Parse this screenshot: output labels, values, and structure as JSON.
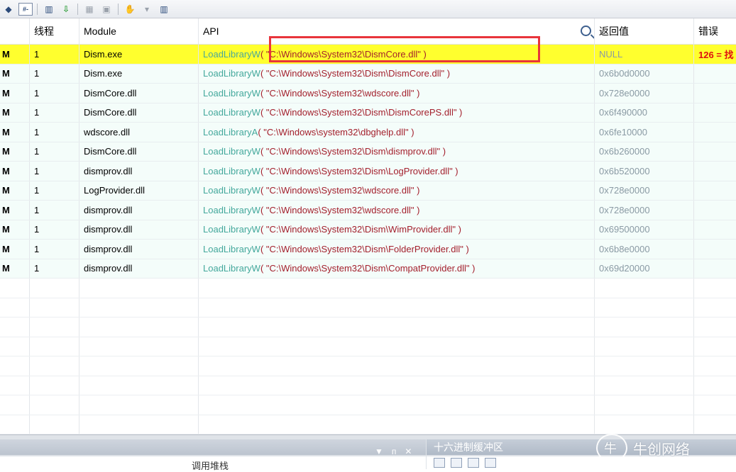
{
  "toolbar": {
    "buttons": [
      {
        "icon": "process-icon"
      },
      {
        "icon": "filter-icon",
        "label": "#-"
      },
      {
        "icon": "columns-icon"
      },
      {
        "icon": "green-arrow-icon"
      },
      {
        "icon": "copy-icon"
      },
      {
        "icon": "delete-icon"
      },
      {
        "icon": "hand-icon"
      },
      {
        "icon": "dropdown-icon"
      },
      {
        "icon": "clear-icon"
      }
    ]
  },
  "table": {
    "headers": [
      "",
      "线程",
      "Module",
      "API",
      "返回值",
      "错误"
    ],
    "rows": [
      {
        "col0": "M",
        "thread": "1",
        "module": "Dism.exe",
        "fn": "LoadLibraryW",
        "args": " ( \"C:\\Windows\\System32\\DismCore.dll\" )",
        "ret": "NULL",
        "err": "126 = 找",
        "selected": true
      },
      {
        "col0": "M",
        "thread": "1",
        "module": "Dism.exe",
        "fn": "LoadLibraryW",
        "args": " ( \"C:\\Windows\\System32\\Dism\\DismCore.dll\" )",
        "ret": "0x6b0d0000",
        "err": ""
      },
      {
        "col0": "M",
        "thread": "1",
        "module": "DismCore.dll",
        "fn": "LoadLibraryW",
        "args": " ( \"C:\\Windows\\System32\\wdscore.dll\" )",
        "ret": "0x728e0000",
        "err": ""
      },
      {
        "col0": "M",
        "thread": "1",
        "module": "DismCore.dll",
        "fn": "LoadLibraryW",
        "args": " ( \"C:\\Windows\\System32\\Dism\\DismCorePS.dll\" )",
        "ret": "0x6f490000",
        "err": ""
      },
      {
        "col0": "M",
        "thread": "1",
        "module": "wdscore.dll",
        "fn": "LoadLibraryA",
        "args": " ( \"C:\\Windows\\system32\\dbghelp.dll\" )",
        "ret": "0x6fe10000",
        "err": ""
      },
      {
        "col0": "M",
        "thread": "1",
        "module": "DismCore.dll",
        "fn": "LoadLibraryW",
        "args": " ( \"C:\\Windows\\System32\\Dism\\dismprov.dll\" )",
        "ret": "0x6b260000",
        "err": ""
      },
      {
        "col0": "M",
        "thread": "1",
        "module": "dismprov.dll",
        "fn": "LoadLibraryW",
        "args": " ( \"C:\\Windows\\System32\\Dism\\LogProvider.dll\" )",
        "ret": "0x6b520000",
        "err": ""
      },
      {
        "col0": "M",
        "thread": "1",
        "module": "LogProvider.dll",
        "fn": "LoadLibraryW",
        "args": " ( \"C:\\Windows\\System32\\wdscore.dll\" )",
        "ret": "0x728e0000",
        "err": ""
      },
      {
        "col0": "M",
        "thread": "1",
        "module": "dismprov.dll",
        "fn": "LoadLibraryW",
        "args": " ( \"C:\\Windows\\System32\\wdscore.dll\" )",
        "ret": "0x728e0000",
        "err": ""
      },
      {
        "col0": "M",
        "thread": "1",
        "module": "dismprov.dll",
        "fn": "LoadLibraryW",
        "args": " ( \"C:\\Windows\\System32\\Dism\\WimProvider.dll\" )",
        "ret": "0x69500000",
        "err": ""
      },
      {
        "col0": "M",
        "thread": "1",
        "module": "dismprov.dll",
        "fn": "LoadLibraryW",
        "args": " ( \"C:\\Windows\\System32\\Dism\\FolderProvider.dll\" )",
        "ret": "0x6b8e0000",
        "err": ""
      },
      {
        "col0": "M",
        "thread": "1",
        "module": "dismprov.dll",
        "fn": "LoadLibraryW",
        "args": " ( \"C:\\Windows\\System32\\Dism\\CompatProvider.dll\" )",
        "ret": "0x69d20000",
        "err": ""
      }
    ]
  },
  "bottom": {
    "left_panel_controls": [
      "▼",
      "ᴨ",
      "✕"
    ],
    "left_panel_body_label": "调用堆栈",
    "right_panel_title": "十六进制缓冲区"
  },
  "watermark": {
    "text": "牛创网络"
  },
  "colors": {
    "selected_row": "#ffff2e",
    "row_background": "#f4fdfa",
    "highlight_box": "#e8343b",
    "api_function": "#44a89c",
    "api_args": "#a31f2c",
    "error_text": "#e01010"
  }
}
